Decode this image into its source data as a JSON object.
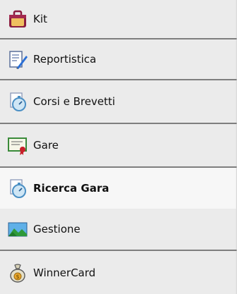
{
  "menu": {
    "items": [
      {
        "label": "Kit",
        "icon": "briefcase-icon",
        "active": false
      },
      {
        "label": "Reportistica",
        "icon": "document-edit-icon",
        "active": false
      },
      {
        "label": "Corsi e Brevetti",
        "icon": "stopwatch-document-icon",
        "active": false
      },
      {
        "label": "Gare",
        "icon": "certificate-icon",
        "active": false
      },
      {
        "label": "Ricerca Gara",
        "icon": "stopwatch-document-icon",
        "active": true
      },
      {
        "label": "Gestione",
        "icon": "landscape-picture-icon",
        "active": false
      },
      {
        "label": "WinnerCard",
        "icon": "money-bag-icon",
        "active": false
      }
    ]
  },
  "colors": {
    "item_background": "#ebebeb",
    "active_background": "#f7f7f7",
    "separator": "#7e7e7e"
  }
}
